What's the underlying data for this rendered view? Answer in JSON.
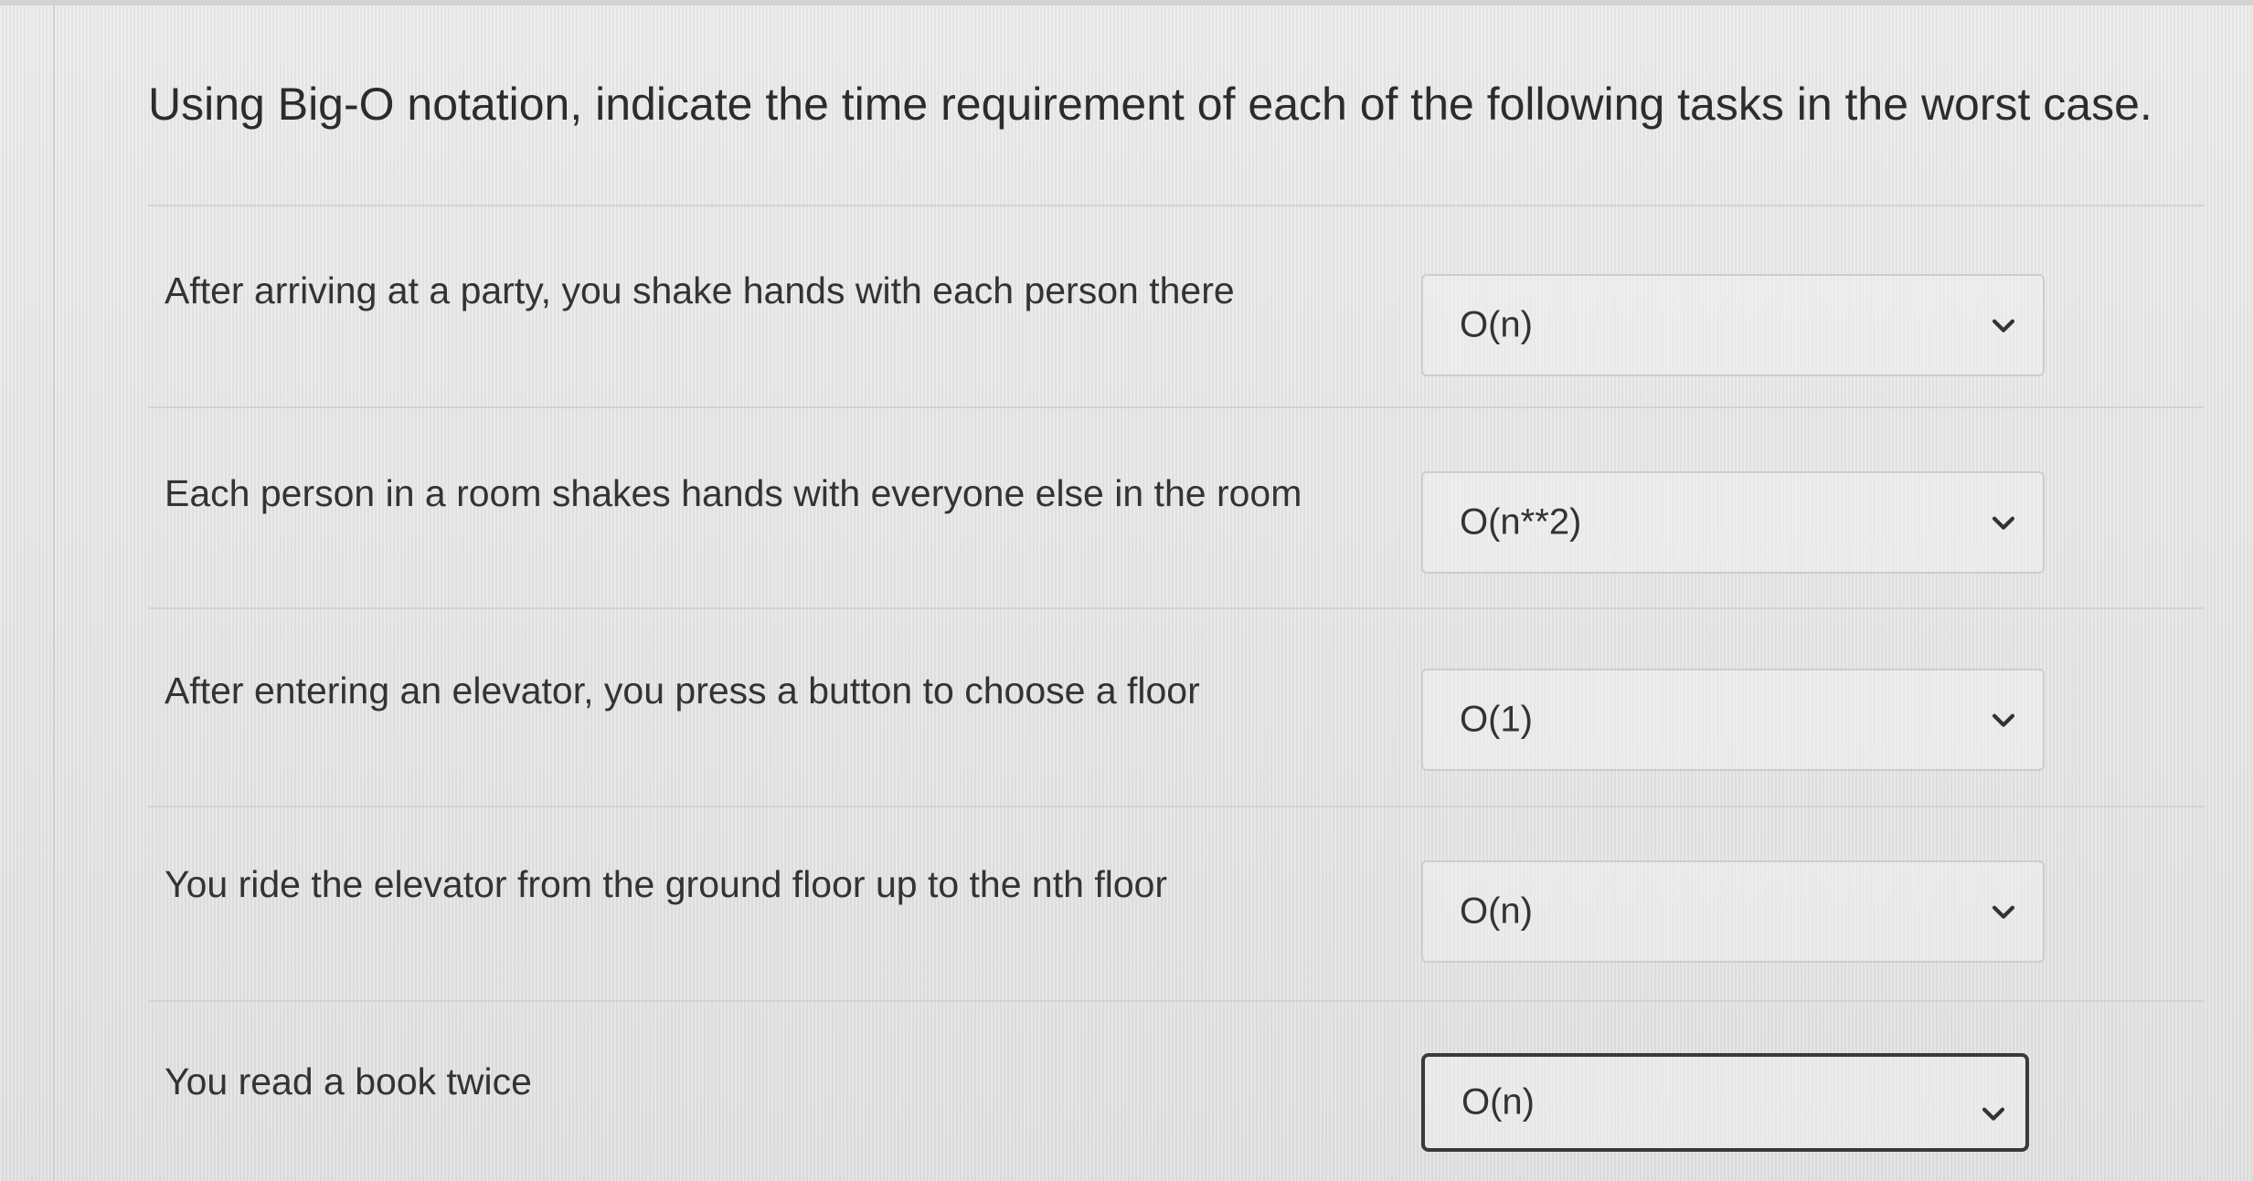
{
  "question": {
    "text": "Using Big-O notation, indicate the time requirement of each of the following tasks in the worst case."
  },
  "rows": [
    {
      "label": "After arriving at a party, you shake hands with each person there",
      "selected": "O(n)"
    },
    {
      "label": "Each person in a room shakes hands with everyone else in the room",
      "selected": "O(n**2)"
    },
    {
      "label": "After entering an elevator, you press a button to choose a floor",
      "selected": "O(1)"
    },
    {
      "label": "You ride the elevator from the ground floor up to the nth floor",
      "selected": "O(n)"
    },
    {
      "label": "You read a book twice",
      "selected": "O(n)"
    }
  ],
  "icons": {
    "dropdown": "chevron-down-icon"
  },
  "colors": {
    "text": "#2f2f2f",
    "select_border": "#cdcdcd",
    "focused_border": "#3a3a3a"
  }
}
